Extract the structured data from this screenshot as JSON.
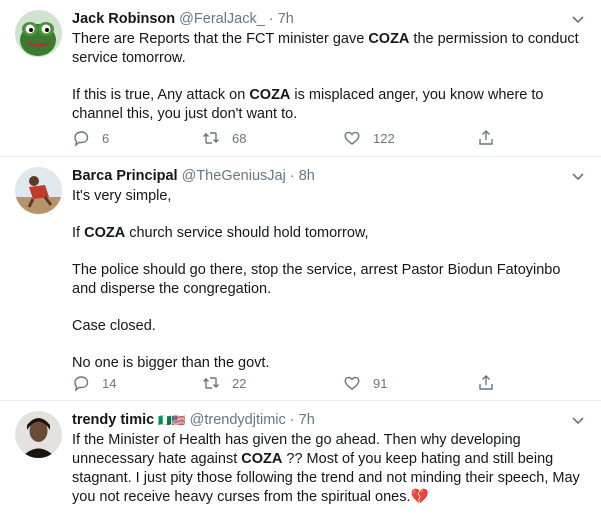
{
  "tweets": [
    {
      "name": "Jack Robinson",
      "handle": "@FeralJack_",
      "dot": "·",
      "time": "7h",
      "paragraphs": [
        [
          {
            "t": "There are Reports that the FCT minister gave "
          },
          {
            "t": "COZA",
            "b": true
          },
          {
            "t": " the permission to conduct service tomorrow."
          }
        ],
        [
          {
            "t": "If this is true, Any attack on "
          },
          {
            "t": "COZA",
            "b": true
          },
          {
            "t": " is misplaced anger, you know where to channel this, you just don't want to."
          }
        ]
      ],
      "replies": "6",
      "retweets": "68",
      "likes": "122"
    },
    {
      "name": "Barca Principal",
      "handle": "@TheGeniusJaj",
      "dot": "·",
      "time": "8h",
      "paragraphs": [
        [
          {
            "t": "It's very simple,"
          }
        ],
        [
          {
            "t": "If "
          },
          {
            "t": "COZA",
            "b": true
          },
          {
            "t": " church service should hold tomorrow,"
          }
        ],
        [
          {
            "t": "The police should go there, stop the service, arrest Pastor Biodun Fatoyinbo and disperse the congregation."
          }
        ],
        [
          {
            "t": "Case closed."
          }
        ],
        [
          {
            "t": "No one is bigger than the govt."
          }
        ]
      ],
      "replies": "14",
      "retweets": "22",
      "likes": "91"
    },
    {
      "name": "trendy timic",
      "name_emoji": "🇳🇬🇺🇸",
      "handle": "@trendydjtimic",
      "dot": "·",
      "time": "7h",
      "paragraphs": [
        [
          {
            "t": "If the Minister of Health has given the go ahead. Then why developing unnecessary hate against "
          },
          {
            "t": "COZA",
            "b": true
          },
          {
            "t": " ?? Most of you keep hating and still being stagnant. I just pity those following the trend and not minding their speech, May you not receive heavy curses from the spiritual ones."
          },
          {
            "t": "💔",
            "emoji": true
          }
        ]
      ]
    }
  ],
  "colors": {
    "text": "#14171a",
    "muted": "#657786",
    "divider": "#e6ecf0",
    "broken_heart": "#e0245e"
  },
  "icons": [
    "chevron-down-icon",
    "reply-icon",
    "retweet-icon",
    "like-icon",
    "share-icon"
  ]
}
